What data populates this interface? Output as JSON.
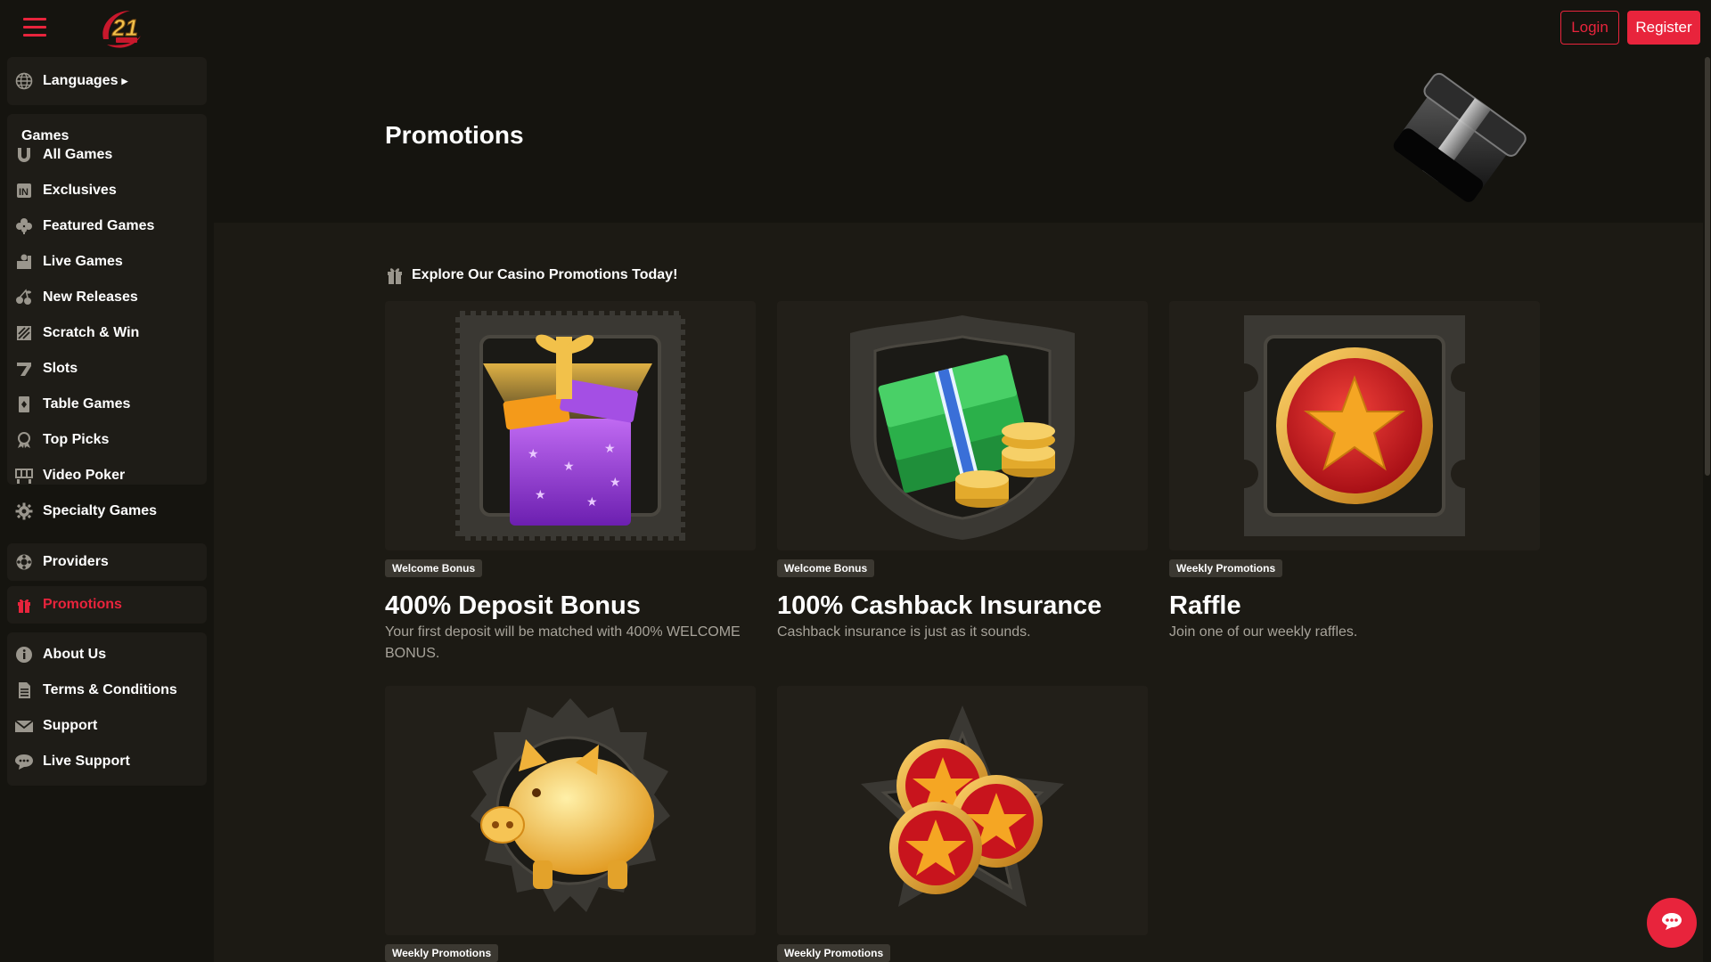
{
  "header": {
    "login_label": "Login",
    "register_label": "Register",
    "logo_text": "21"
  },
  "sidebar": {
    "languages_label": "Languages",
    "games_heading": "Games",
    "games": [
      {
        "label": "All Games",
        "icon": "horseshoe-icon"
      },
      {
        "label": "Exclusives",
        "icon": "exclusive-icon"
      },
      {
        "label": "Featured Games",
        "icon": "clover-icon"
      },
      {
        "label": "Live Games",
        "icon": "live-dealer-icon"
      },
      {
        "label": "New Releases",
        "icon": "cherries-icon"
      },
      {
        "label": "Scratch & Win",
        "icon": "scratch-card-icon"
      },
      {
        "label": "Slots",
        "icon": "seven-icon"
      },
      {
        "label": "Table Games",
        "icon": "playing-card-icon"
      },
      {
        "label": "Top Picks",
        "icon": "award-icon"
      },
      {
        "label": "Video Poker",
        "icon": "video-poker-icon"
      },
      {
        "label": "Specialty Games",
        "icon": "gear-icon"
      }
    ],
    "providers_label": "Providers",
    "promotions_label": "Promotions",
    "info": [
      {
        "label": "About Us",
        "icon": "info-icon"
      },
      {
        "label": "Terms & Conditions",
        "icon": "document-icon"
      },
      {
        "label": "Support",
        "icon": "mail-icon"
      },
      {
        "label": "Live Support",
        "icon": "chat-bubble-icon"
      }
    ]
  },
  "main": {
    "page_title": "Promotions",
    "explore_label": "Explore Our Casino Promotions Today!",
    "cards": [
      {
        "badge": "Welcome Bonus",
        "title": "400% Deposit Bonus",
        "description": "Your first deposit will be matched with 400% WELCOME BONUS."
      },
      {
        "badge": "Welcome Bonus",
        "title": "100% Cashback Insurance",
        "description": "Cashback insurance is just as it sounds."
      },
      {
        "badge": "Weekly Promotions",
        "title": "Raffle",
        "description": "Join one of our weekly raffles."
      },
      {
        "badge": "Weekly Promotions",
        "title": "",
        "description": ""
      },
      {
        "badge": "Weekly Promotions",
        "title": "",
        "description": ""
      }
    ]
  },
  "colors": {
    "accent": "#e8243c",
    "background": "#1c1a14",
    "sidebar": "#15140f"
  }
}
